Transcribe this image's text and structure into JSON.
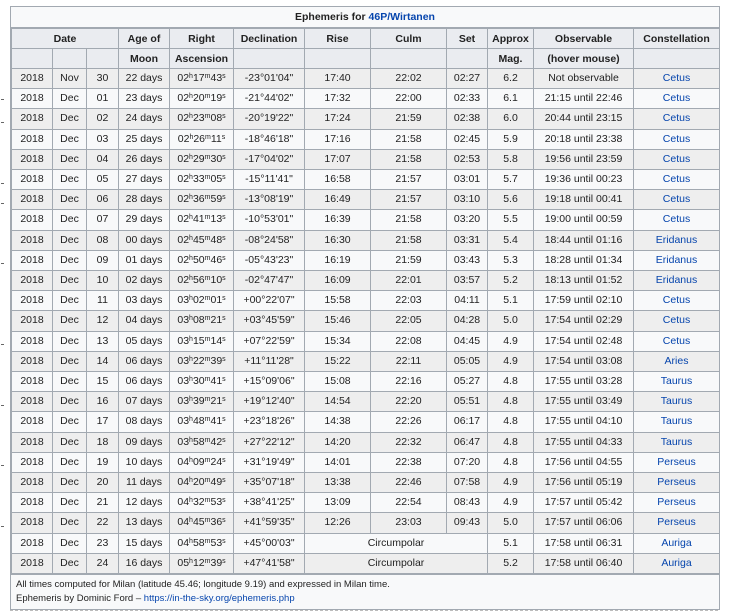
{
  "caption": {
    "prefix": "Ephemeris for ",
    "link": "46P/Wirtanen"
  },
  "headers": {
    "date": "Date",
    "age": "Age of",
    "age2": "Moon",
    "ra": "Right",
    "ra2": "Ascension",
    "dec": "Declination",
    "rise": "Rise",
    "culm": "Culm",
    "set": "Set",
    "mag": "Approx",
    "mag2": "Mag.",
    "obs": "Observable",
    "obs2": "(hover mouse)",
    "const": "Constellation"
  },
  "rows": [
    {
      "y": "2018",
      "m": "Nov",
      "d": "30",
      "age": "22 days",
      "ra_h": "02",
      "ra_m": "17",
      "ra_s": "43",
      "dec": "-23°01'04\"",
      "rise": "17:40",
      "culm": "22:02",
      "set": "02:27",
      "mag": "6.2",
      "obs": "Not observable",
      "con": "Cetus"
    },
    {
      "y": "2018",
      "m": "Dec",
      "d": "01",
      "age": "23 days",
      "ra_h": "02",
      "ra_m": "20",
      "ra_s": "19",
      "dec": "-21°44'02\"",
      "rise": "17:32",
      "culm": "22:00",
      "set": "02:33",
      "mag": "6.1",
      "obs": "21:15 until 22:46",
      "con": "Cetus"
    },
    {
      "y": "2018",
      "m": "Dec",
      "d": "02",
      "age": "24 days",
      "ra_h": "02",
      "ra_m": "23",
      "ra_s": "08",
      "dec": "-20°19'22\"",
      "rise": "17:24",
      "culm": "21:59",
      "set": "02:38",
      "mag": "6.0",
      "obs": "20:44 until 23:15",
      "con": "Cetus"
    },
    {
      "y": "2018",
      "m": "Dec",
      "d": "03",
      "age": "25 days",
      "ra_h": "02",
      "ra_m": "26",
      "ra_s": "11",
      "dec": "-18°46'18\"",
      "rise": "17:16",
      "culm": "21:58",
      "set": "02:45",
      "mag": "5.9",
      "obs": "20:18 until 23:38",
      "con": "Cetus"
    },
    {
      "y": "2018",
      "m": "Dec",
      "d": "04",
      "age": "26 days",
      "ra_h": "02",
      "ra_m": "29",
      "ra_s": "30",
      "dec": "-17°04'02\"",
      "rise": "17:07",
      "culm": "21:58",
      "set": "02:53",
      "mag": "5.8",
      "obs": "19:56 until 23:59",
      "con": "Cetus"
    },
    {
      "y": "2018",
      "m": "Dec",
      "d": "05",
      "age": "27 days",
      "ra_h": "02",
      "ra_m": "33",
      "ra_s": "05",
      "dec": "-15°11'41\"",
      "rise": "16:58",
      "culm": "21:57",
      "set": "03:01",
      "mag": "5.7",
      "obs": "19:36 until 00:23",
      "con": "Cetus"
    },
    {
      "y": "2018",
      "m": "Dec",
      "d": "06",
      "age": "28 days",
      "ra_h": "02",
      "ra_m": "36",
      "ra_s": "59",
      "dec": "-13°08'19\"",
      "rise": "16:49",
      "culm": "21:57",
      "set": "03:10",
      "mag": "5.6",
      "obs": "19:18 until 00:41",
      "con": "Cetus"
    },
    {
      "y": "2018",
      "m": "Dec",
      "d": "07",
      "age": "29 days",
      "ra_h": "02",
      "ra_m": "41",
      "ra_s": "13",
      "dec": "-10°53'01\"",
      "rise": "16:39",
      "culm": "21:58",
      "set": "03:20",
      "mag": "5.5",
      "obs": "19:00 until 00:59",
      "con": "Cetus"
    },
    {
      "y": "2018",
      "m": "Dec",
      "d": "08",
      "age": "00 days",
      "ra_h": "02",
      "ra_m": "45",
      "ra_s": "48",
      "dec": "-08°24'58\"",
      "rise": "16:30",
      "culm": "21:58",
      "set": "03:31",
      "mag": "5.4",
      "obs": "18:44 until 01:16",
      "con": "Eridanus"
    },
    {
      "y": "2018",
      "m": "Dec",
      "d": "09",
      "age": "01 days",
      "ra_h": "02",
      "ra_m": "50",
      "ra_s": "46",
      "dec": "-05°43'23\"",
      "rise": "16:19",
      "culm": "21:59",
      "set": "03:43",
      "mag": "5.3",
      "obs": "18:28 until 01:34",
      "con": "Eridanus"
    },
    {
      "y": "2018",
      "m": "Dec",
      "d": "10",
      "age": "02 days",
      "ra_h": "02",
      "ra_m": "56",
      "ra_s": "10",
      "dec": "-02°47'47\"",
      "rise": "16:09",
      "culm": "22:01",
      "set": "03:57",
      "mag": "5.2",
      "obs": "18:13 until 01:52",
      "con": "Eridanus"
    },
    {
      "y": "2018",
      "m": "Dec",
      "d": "11",
      "age": "03 days",
      "ra_h": "03",
      "ra_m": "02",
      "ra_s": "01",
      "dec": "+00°22'07\"",
      "rise": "15:58",
      "culm": "22:03",
      "set": "04:11",
      "mag": "5.1",
      "obs": "17:59 until 02:10",
      "con": "Cetus"
    },
    {
      "y": "2018",
      "m": "Dec",
      "d": "12",
      "age": "04 days",
      "ra_h": "03",
      "ra_m": "08",
      "ra_s": "21",
      "dec": "+03°45'59\"",
      "rise": "15:46",
      "culm": "22:05",
      "set": "04:28",
      "mag": "5.0",
      "obs": "17:54 until 02:29",
      "con": "Cetus"
    },
    {
      "y": "2018",
      "m": "Dec",
      "d": "13",
      "age": "05 days",
      "ra_h": "03",
      "ra_m": "15",
      "ra_s": "14",
      "dec": "+07°22'59\"",
      "rise": "15:34",
      "culm": "22:08",
      "set": "04:45",
      "mag": "4.9",
      "obs": "17:54 until 02:48",
      "con": "Cetus"
    },
    {
      "y": "2018",
      "m": "Dec",
      "d": "14",
      "age": "06 days",
      "ra_h": "03",
      "ra_m": "22",
      "ra_s": "39",
      "dec": "+11°11'28\"",
      "rise": "15:22",
      "culm": "22:11",
      "set": "05:05",
      "mag": "4.9",
      "obs": "17:54 until 03:08",
      "con": "Aries"
    },
    {
      "y": "2018",
      "m": "Dec",
      "d": "15",
      "age": "06 days",
      "ra_h": "03",
      "ra_m": "30",
      "ra_s": "41",
      "dec": "+15°09'06\"",
      "rise": "15:08",
      "culm": "22:16",
      "set": "05:27",
      "mag": "4.8",
      "obs": "17:55 until 03:28",
      "con": "Taurus"
    },
    {
      "y": "2018",
      "m": "Dec",
      "d": "16",
      "age": "07 days",
      "ra_h": "03",
      "ra_m": "39",
      "ra_s": "21",
      "dec": "+19°12'40\"",
      "rise": "14:54",
      "culm": "22:20",
      "set": "05:51",
      "mag": "4.8",
      "obs": "17:55 until 03:49",
      "con": "Taurus"
    },
    {
      "y": "2018",
      "m": "Dec",
      "d": "17",
      "age": "08 days",
      "ra_h": "03",
      "ra_m": "48",
      "ra_s": "41",
      "dec": "+23°18'26\"",
      "rise": "14:38",
      "culm": "22:26",
      "set": "06:17",
      "mag": "4.8",
      "obs": "17:55 until 04:10",
      "con": "Taurus"
    },
    {
      "y": "2018",
      "m": "Dec",
      "d": "18",
      "age": "09 days",
      "ra_h": "03",
      "ra_m": "58",
      "ra_s": "42",
      "dec": "+27°22'12\"",
      "rise": "14:20",
      "culm": "22:32",
      "set": "06:47",
      "mag": "4.8",
      "obs": "17:55 until 04:33",
      "con": "Taurus"
    },
    {
      "y": "2018",
      "m": "Dec",
      "d": "19",
      "age": "10 days",
      "ra_h": "04",
      "ra_m": "09",
      "ra_s": "24",
      "dec": "+31°19'49\"",
      "rise": "14:01",
      "culm": "22:38",
      "set": "07:20",
      "mag": "4.8",
      "obs": "17:56 until 04:55",
      "con": "Perseus"
    },
    {
      "y": "2018",
      "m": "Dec",
      "d": "20",
      "age": "11 days",
      "ra_h": "04",
      "ra_m": "20",
      "ra_s": "49",
      "dec": "+35°07'18\"",
      "rise": "13:38",
      "culm": "22:46",
      "set": "07:58",
      "mag": "4.9",
      "obs": "17:56 until 05:19",
      "con": "Perseus"
    },
    {
      "y": "2018",
      "m": "Dec",
      "d": "21",
      "age": "12 days",
      "ra_h": "04",
      "ra_m": "32",
      "ra_s": "53",
      "dec": "+38°41'25\"",
      "rise": "13:09",
      "culm": "22:54",
      "set": "08:43",
      "mag": "4.9",
      "obs": "17:57 until 05:42",
      "con": "Perseus"
    },
    {
      "y": "2018",
      "m": "Dec",
      "d": "22",
      "age": "13 days",
      "ra_h": "04",
      "ra_m": "45",
      "ra_s": "36",
      "dec": "+41°59'35\"",
      "rise": "12:26",
      "culm": "23:03",
      "set": "09:43",
      "mag": "5.0",
      "obs": "17:57 until 06:06",
      "con": "Perseus"
    },
    {
      "y": "2018",
      "m": "Dec",
      "d": "23",
      "age": "15 days",
      "ra_h": "04",
      "ra_m": "58",
      "ra_s": "53",
      "dec": "+45°00'03\"",
      "circ": "Circumpolar",
      "mag": "5.1",
      "obs": "17:58 until 06:31",
      "con": "Auriga"
    },
    {
      "y": "2018",
      "m": "Dec",
      "d": "24",
      "age": "16 days",
      "ra_h": "05",
      "ra_m": "12",
      "ra_s": "39",
      "dec": "+47°41'58\"",
      "circ": "Circumpolar",
      "mag": "5.2",
      "obs": "17:58 until 06:40",
      "con": "Auriga"
    }
  ],
  "footer": {
    "line1": "All times computed for Milan (latitude 45.46; longitude 9.19) and expressed in Milan time.",
    "line2_prefix": "Ephemeris by Dominic Ford – ",
    "line2_link": "https://in-the-sky.org/ephemeris.php"
  },
  "colors": {
    "link": "#0645ad",
    "header_bg": "#eaecf0",
    "border": "#a2a9b1"
  }
}
